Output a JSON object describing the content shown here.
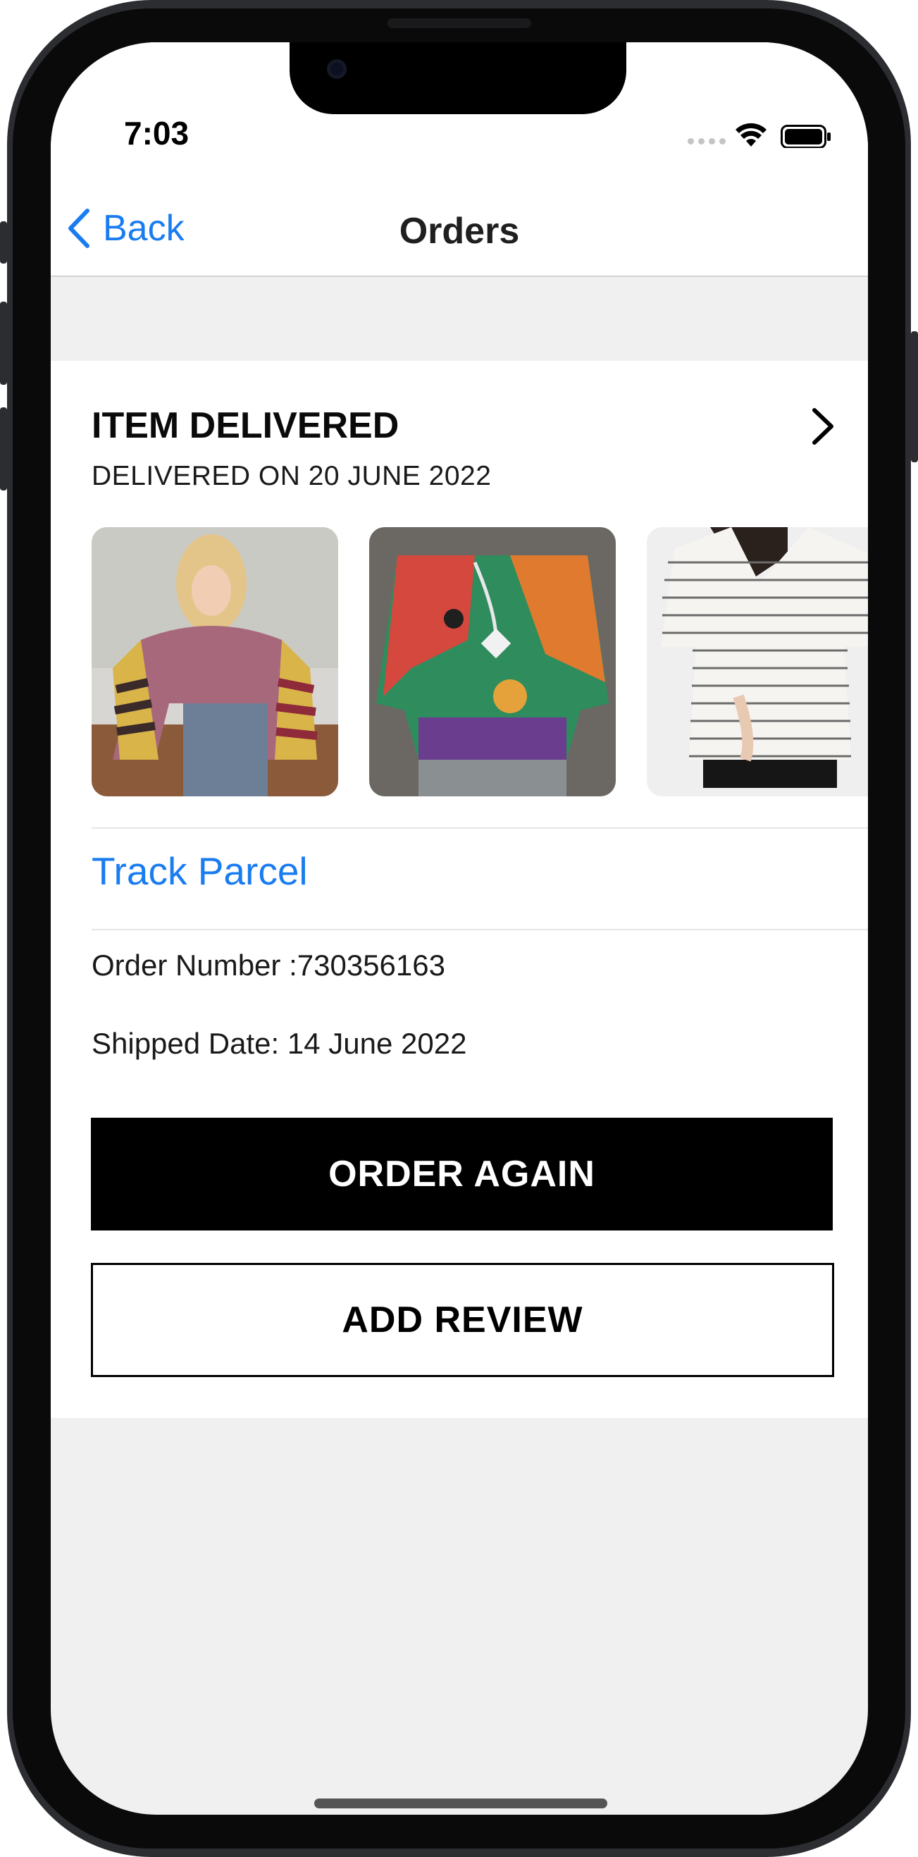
{
  "status_bar": {
    "time": "7:03",
    "wifi_icon": "wifi-icon",
    "battery_icon": "battery-full-icon"
  },
  "nav": {
    "back_label": "Back",
    "back_icon": "chevron-left-icon",
    "title": "Orders"
  },
  "order": {
    "status_title": "ITEM DELIVERED",
    "status_subtitle": "DELIVERED ON 20 JUNE 2022",
    "detail_icon": "chevron-right-icon",
    "products": [
      {
        "image": "pink-sweater-striped-sleeves"
      },
      {
        "image": "colorful-abstract-print-top"
      },
      {
        "image": "white-striped-oversized-tee"
      }
    ],
    "track_label": "Track Parcel",
    "order_number": "Order Number :730356163",
    "shipped_date": "Shipped Date: 14 June 2022",
    "order_again_label": "ORDER AGAIN",
    "add_review_label": "ADD REVIEW"
  },
  "colors": {
    "accent": "#1a7cf1",
    "primary_button": "#000000",
    "background": "#f0f0f0"
  }
}
